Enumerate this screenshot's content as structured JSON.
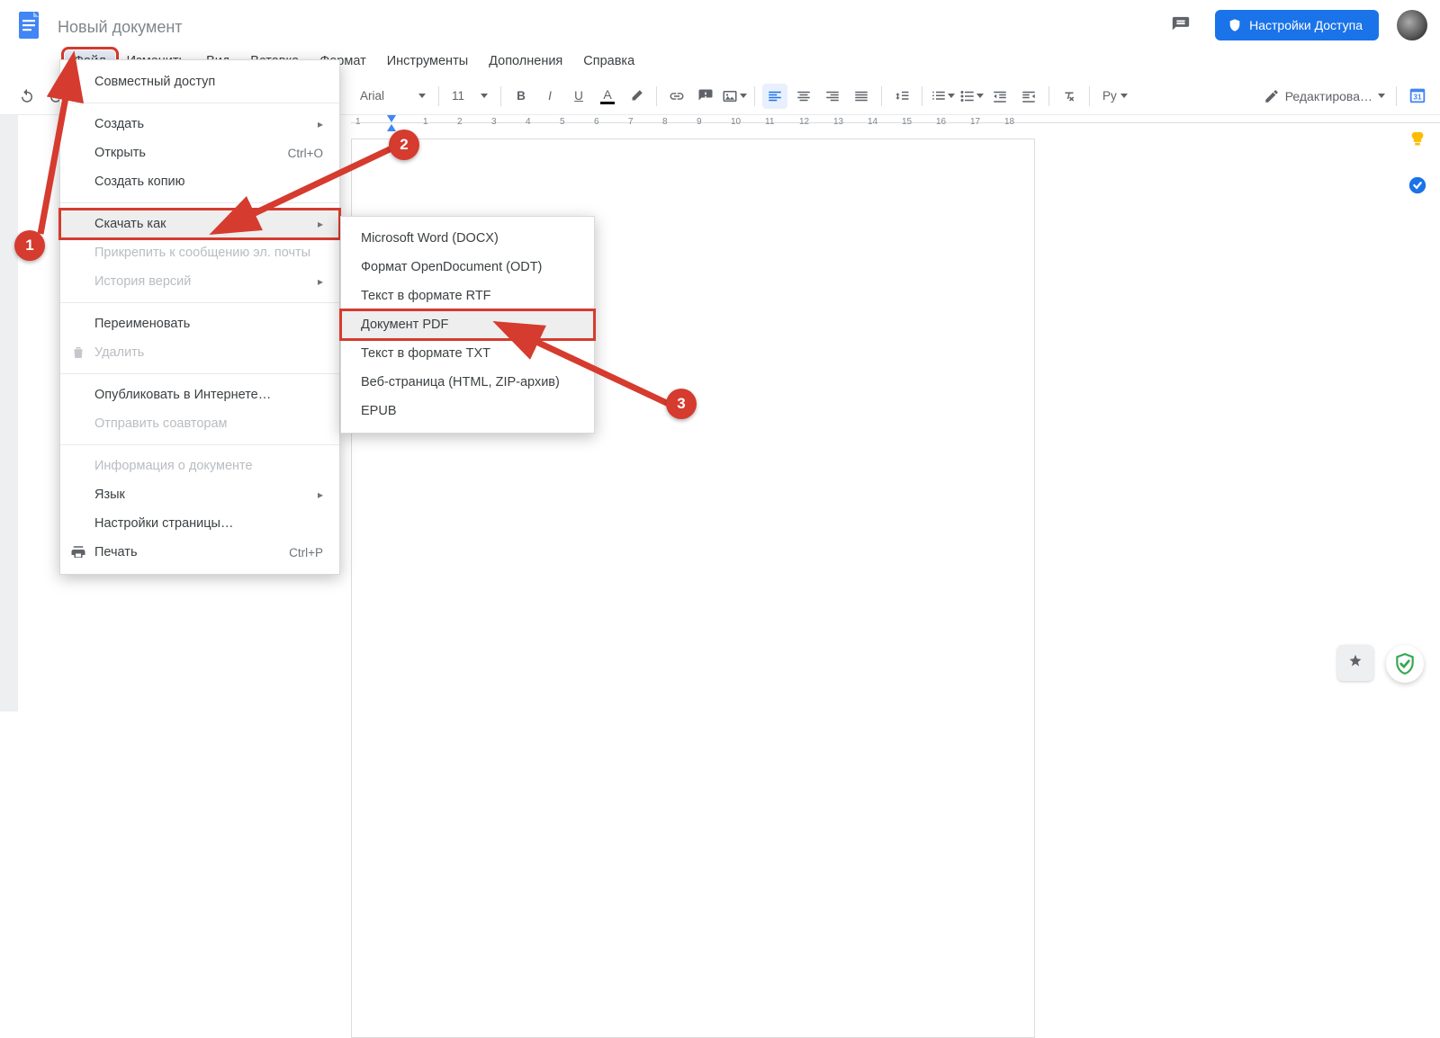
{
  "header": {
    "doc_title": "Новый документ",
    "share_label": "Настройки Доступа"
  },
  "menu": {
    "items": [
      "Файл",
      "Изменить",
      "Вид",
      "Вставка",
      "Формат",
      "Инструменты",
      "Дополнения",
      "Справка"
    ]
  },
  "toolbar": {
    "font": "Arial",
    "font_size": "11",
    "spelling": "Ру",
    "edit_mode": "Редактирова…"
  },
  "file_menu": {
    "share": "Совместный доступ",
    "create": "Создать",
    "open": "Открыть",
    "open_shortcut": "Ctrl+O",
    "copy": "Создать копию",
    "download_as": "Скачать как",
    "attach_email": "Прикрепить к сообщению эл. почты",
    "version_history": "История версий",
    "rename": "Переименовать",
    "delete": "Удалить",
    "publish": "Опубликовать в Интернете…",
    "send_coauthors": "Отправить соавторам",
    "doc_info": "Информация о документе",
    "language": "Язык",
    "page_setup": "Настройки страницы…",
    "print": "Печать",
    "print_shortcut": "Ctrl+P"
  },
  "download_sub": {
    "docx": "Microsoft Word (DOCX)",
    "odt": "Формат OpenDocument (ODT)",
    "rtf": "Текст в формате RTF",
    "pdf": "Документ PDF",
    "txt": "Текст в формате TXT",
    "html": "Веб-страница (HTML, ZIP-архив)",
    "epub": "EPUB"
  },
  "ruler_numbers": [
    "1",
    "1",
    "2",
    "3",
    "4",
    "5",
    "6",
    "7",
    "8",
    "9",
    "10",
    "11",
    "12",
    "13",
    "14",
    "15",
    "16",
    "17",
    "18"
  ],
  "annotations": {
    "n1": "1",
    "n2": "2",
    "n3": "3"
  }
}
